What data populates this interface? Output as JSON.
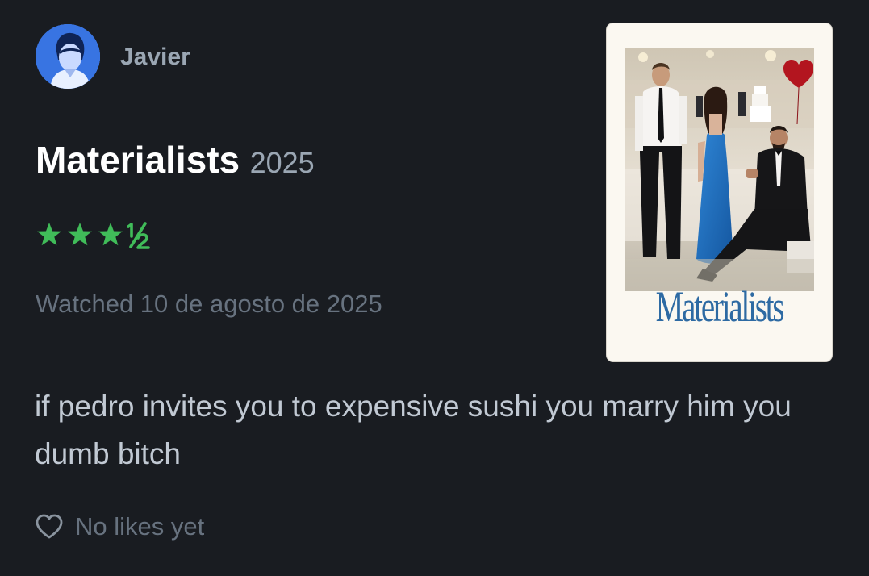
{
  "user": {
    "name": "Javier"
  },
  "film": {
    "title": "Materialists",
    "year": "2025",
    "poster_title": "Materialists"
  },
  "rating": {
    "stars": 3.5,
    "color": "#40bc59"
  },
  "watched_text": "Watched 10 de agosto de 2025",
  "review_text": "if pedro invites you to expensive sushi you marry him you dumb bitch",
  "likes": {
    "icon": "heart-outline-icon",
    "text": "No likes yet"
  },
  "colors": {
    "background": "#191c21",
    "title": "#ffffff",
    "muted": "#67727f",
    "star": "#40bc59",
    "avatar": "#2f6bdc"
  }
}
